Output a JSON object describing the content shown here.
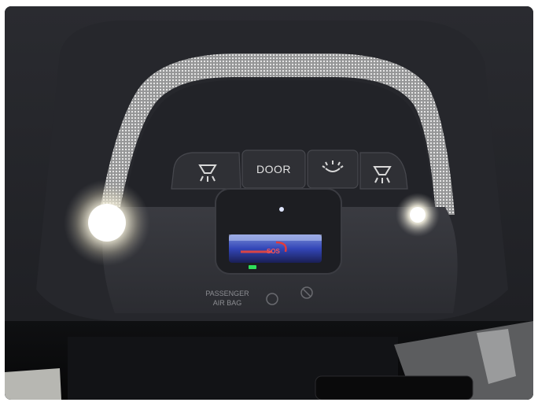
{
  "overhead_console": {
    "buttons": [
      {
        "label": "",
        "icon": "map-light-left-icon"
      },
      {
        "label": "DOOR",
        "icon": ""
      },
      {
        "label": "",
        "icon": "dome-light-icon"
      },
      {
        "label": "",
        "icon": "map-light-right-icon"
      }
    ],
    "sos_label": "SOS",
    "airbag_label_line1": "PASSENGER",
    "airbag_label_line2": "AIR BAG",
    "status_led_color": "#2fe05a",
    "light_color": "#ffffff"
  }
}
